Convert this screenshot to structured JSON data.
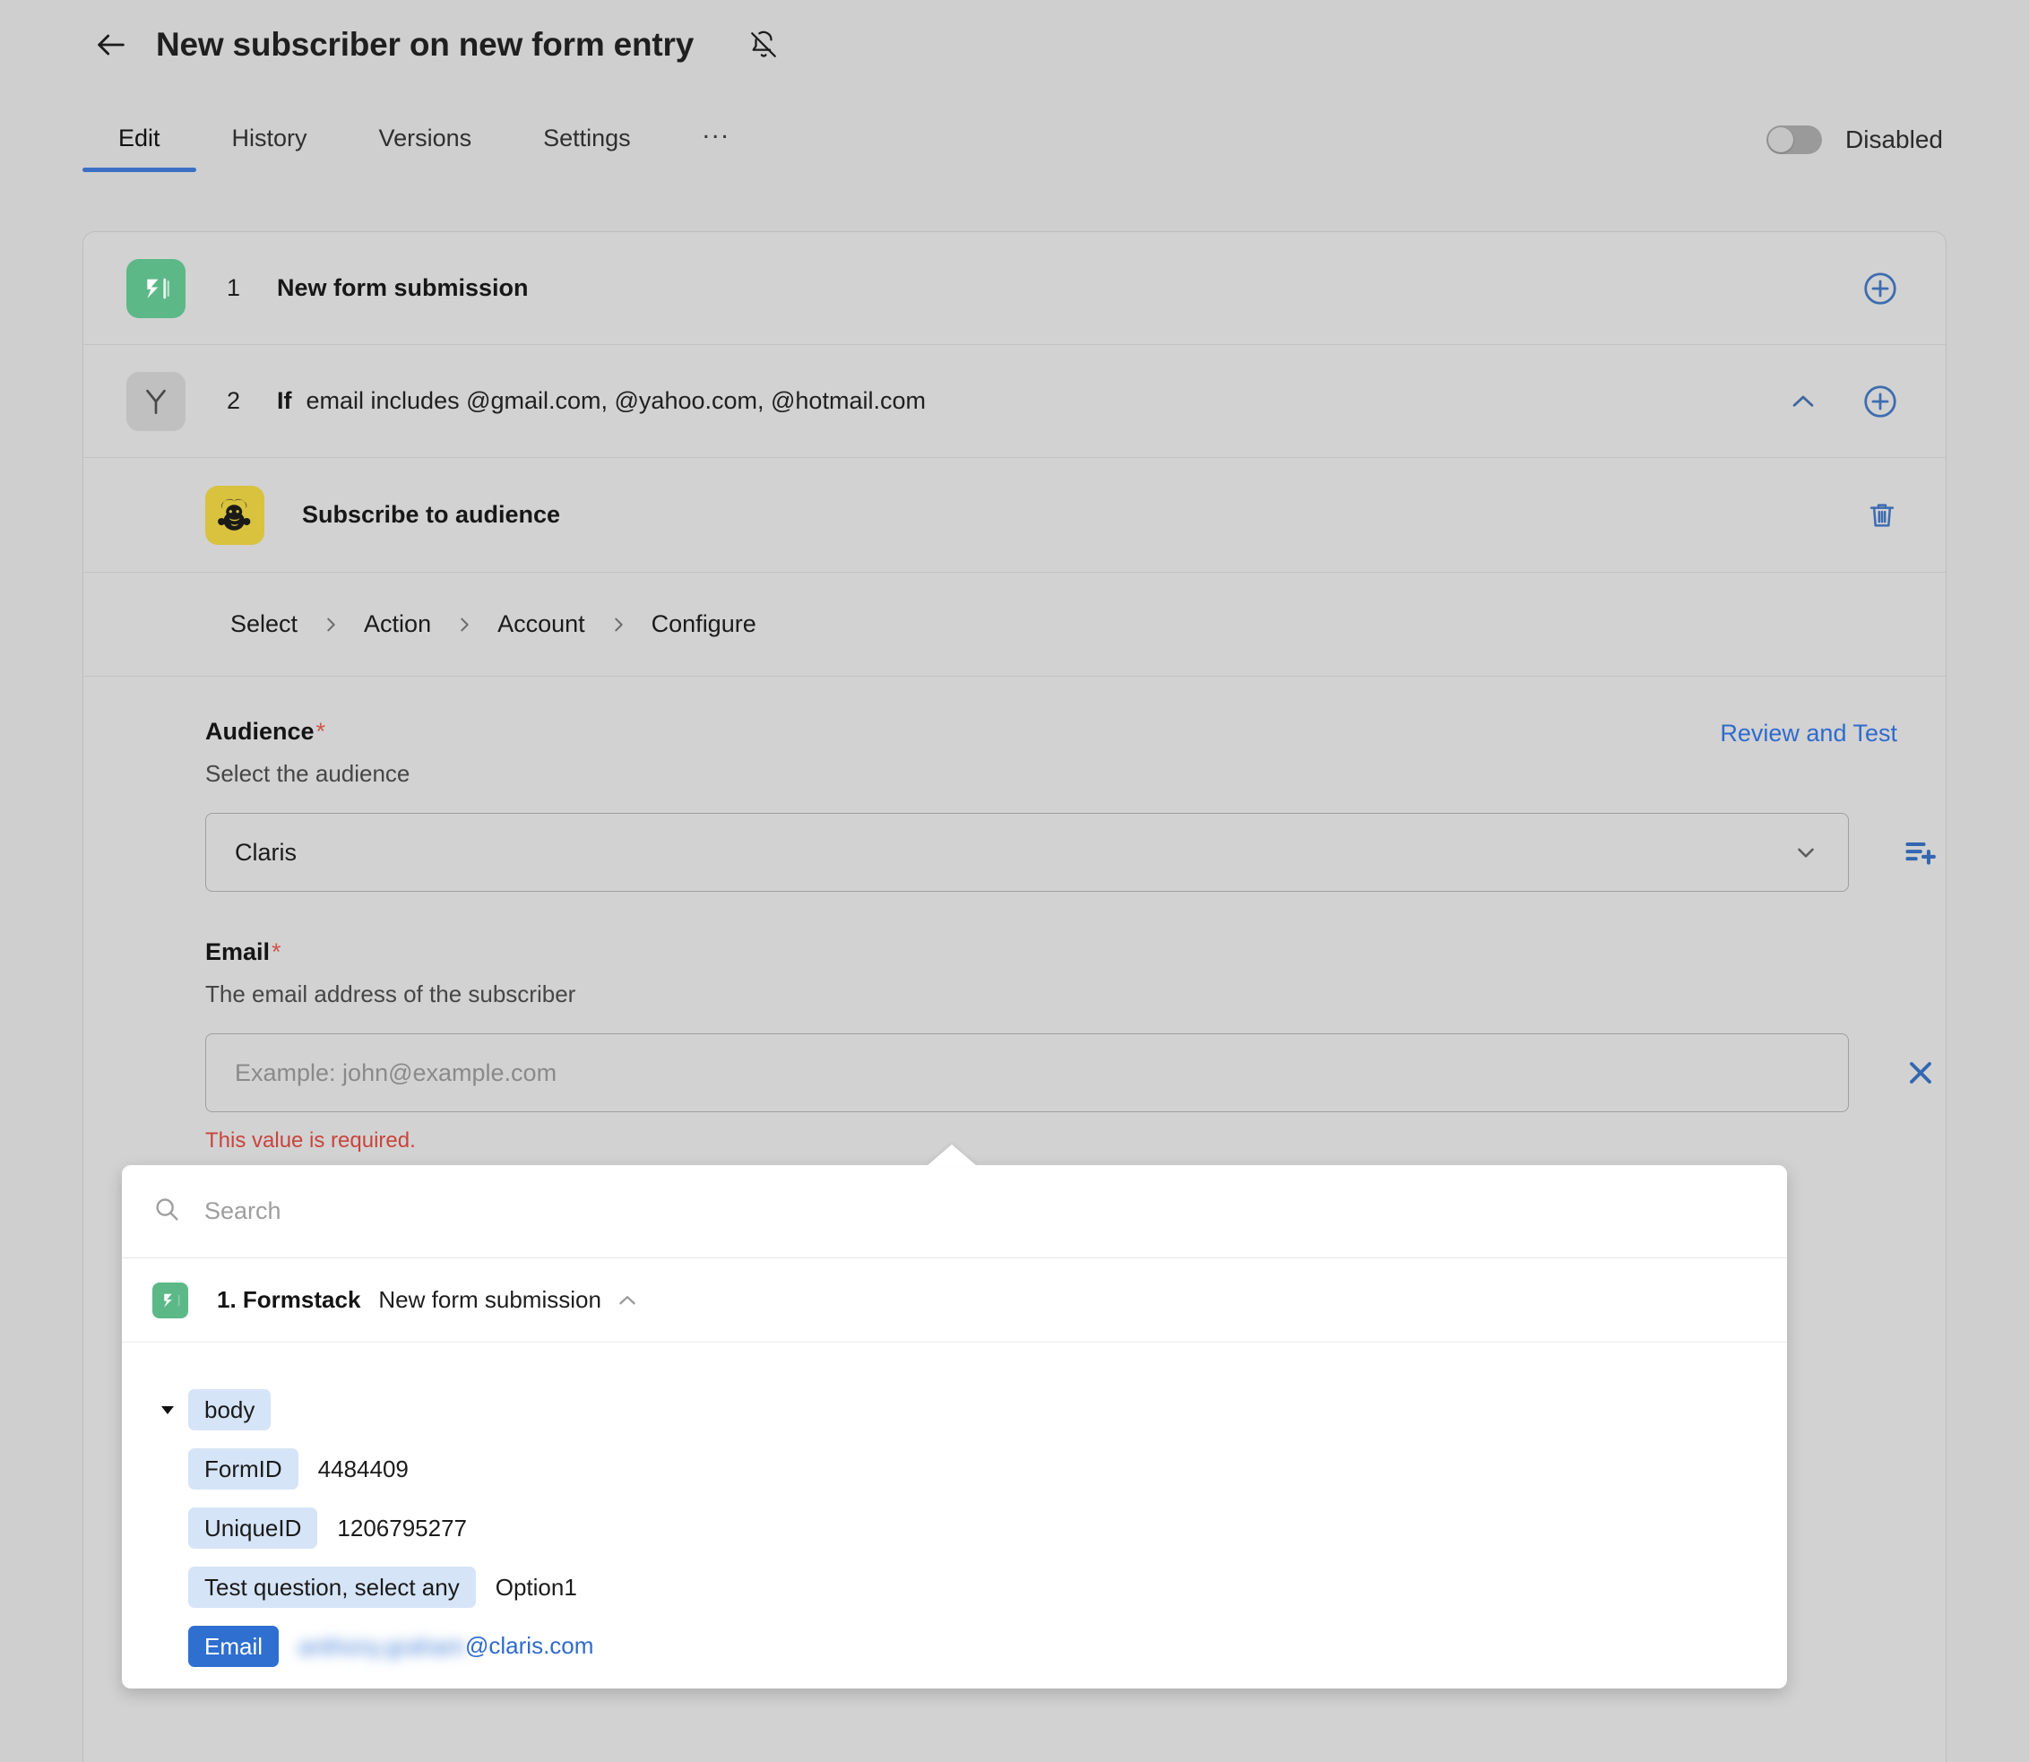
{
  "header": {
    "title": "New subscriber on new form entry",
    "back_icon": "arrow-left-icon",
    "notification_icon": "bell-off-icon"
  },
  "tabs": {
    "items": [
      {
        "label": "Edit",
        "active": true
      },
      {
        "label": "History",
        "active": false
      },
      {
        "label": "Versions",
        "active": false
      },
      {
        "label": "Settings",
        "active": false
      }
    ],
    "overflow_label": "...",
    "toggle": {
      "label": "Disabled",
      "state": "off"
    }
  },
  "steps": [
    {
      "number": "1",
      "label": "New form submission",
      "icon": "formstack-icon",
      "add_icon": "plus-circle-icon"
    },
    {
      "number": "2",
      "prefix": "If",
      "condition": "email includes @gmail.com, @yahoo.com, @hotmail.com",
      "icon": "branch-icon",
      "collapse_icon": "chevron-up-icon",
      "add_icon": "plus-circle-icon"
    },
    {
      "label": "Subscribe to audience",
      "icon": "mailchimp-icon",
      "delete_icon": "trash-icon"
    }
  ],
  "breadcrumb": {
    "items": [
      "Select",
      "Action",
      "Account",
      "Configure"
    ],
    "separator_icon": "chevron-right-icon"
  },
  "form": {
    "review_and_test": "Review and Test",
    "audience": {
      "label": "Audience",
      "required_mark": "*",
      "help": "Select the audience",
      "value": "Claris",
      "chevron_icon": "chevron-down-icon",
      "side_icon": "list-add-icon"
    },
    "email": {
      "label": "Email",
      "required_mark": "*",
      "help": "The email address of the subscriber",
      "value": "",
      "placeholder": "Example: john@example.com",
      "error": "This value is required.",
      "side_icon": "close-icon"
    }
  },
  "popup": {
    "search_placeholder": "Search",
    "search_value": "",
    "search_icon": "search-icon",
    "source": {
      "index_label": "1. Formstack",
      "name": "New form submission",
      "icon": "formstack-icon",
      "chevron_icon": "chevron-up-icon"
    },
    "tree": {
      "root": {
        "label": "body",
        "caret_icon": "caret-down-icon"
      },
      "fields": [
        {
          "label": "FormID",
          "value": "4484409",
          "selected": false
        },
        {
          "label": "UniqueID",
          "value": "1206795277",
          "selected": false
        },
        {
          "label": "Test question, select any",
          "value": "Option1",
          "selected": false
        },
        {
          "label": "Email",
          "value_redacted": "anthony.graham",
          "value_suffix": "@claris.com",
          "selected": true
        }
      ]
    }
  },
  "colors": {
    "page_background": "#cfcfcf",
    "card_background": "#d2d2d2",
    "accent_blue": "#2f6bcd",
    "error_red": "#c9443c",
    "formstack_green": "#5cb887",
    "mailchimp_yellow": "#d9c23d",
    "chip_blue": "#d6e4f7"
  }
}
